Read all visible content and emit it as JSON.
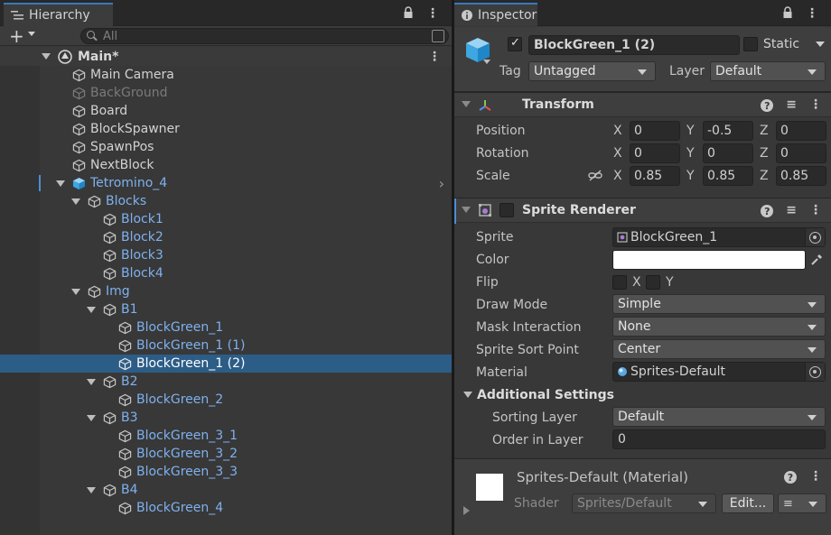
{
  "hierarchy": {
    "tab_label": "Hierarchy",
    "add_label": "+",
    "search_placeholder": "All",
    "scene": "Main*",
    "items": [
      {
        "label": "Main Camera",
        "depth": 0,
        "kind": "go",
        "style": "normal"
      },
      {
        "label": "BackGround",
        "depth": 0,
        "kind": "go",
        "style": "grey"
      },
      {
        "label": "Board",
        "depth": 0,
        "kind": "go",
        "style": "normal"
      },
      {
        "label": "BlockSpawner",
        "depth": 0,
        "kind": "go",
        "style": "normal"
      },
      {
        "label": "SpawnPos",
        "depth": 0,
        "kind": "go",
        "style": "normal"
      },
      {
        "label": "NextBlock",
        "depth": 0,
        "kind": "go",
        "style": "normal"
      },
      {
        "label": "Tetromino_4",
        "depth": 0,
        "kind": "prefab",
        "style": "blue",
        "expanded": true
      },
      {
        "label": "Blocks",
        "depth": 1,
        "kind": "go",
        "style": "blue",
        "expanded": true
      },
      {
        "label": "Block1",
        "depth": 2,
        "kind": "go",
        "style": "blue"
      },
      {
        "label": "Block2",
        "depth": 2,
        "kind": "go",
        "style": "blue"
      },
      {
        "label": "Block3",
        "depth": 2,
        "kind": "go",
        "style": "blue"
      },
      {
        "label": "Block4",
        "depth": 2,
        "kind": "go",
        "style": "blue"
      },
      {
        "label": "Img",
        "depth": 1,
        "kind": "go",
        "style": "blue",
        "expanded": true
      },
      {
        "label": "B1",
        "depth": 2,
        "kind": "go",
        "style": "blue",
        "expanded": true
      },
      {
        "label": "BlockGreen_1",
        "depth": 3,
        "kind": "go",
        "style": "blue"
      },
      {
        "label": "BlockGreen_1 (1)",
        "depth": 3,
        "kind": "go",
        "style": "blue"
      },
      {
        "label": "BlockGreen_1 (2)",
        "depth": 3,
        "kind": "go",
        "style": "blue",
        "selected": true
      },
      {
        "label": "B2",
        "depth": 2,
        "kind": "go",
        "style": "blue",
        "expanded": true
      },
      {
        "label": "BlockGreen_2",
        "depth": 3,
        "kind": "go",
        "style": "blue"
      },
      {
        "label": "B3",
        "depth": 2,
        "kind": "go",
        "style": "blue",
        "expanded": true
      },
      {
        "label": "BlockGreen_3_1",
        "depth": 3,
        "kind": "go",
        "style": "blue"
      },
      {
        "label": "BlockGreen_3_2",
        "depth": 3,
        "kind": "go",
        "style": "blue"
      },
      {
        "label": "BlockGreen_3_3",
        "depth": 3,
        "kind": "go",
        "style": "blue"
      },
      {
        "label": "B4",
        "depth": 2,
        "kind": "go",
        "style": "blue",
        "expanded": true
      },
      {
        "label": "BlockGreen_4",
        "depth": 3,
        "kind": "go",
        "style": "blue"
      }
    ]
  },
  "inspector": {
    "tab_label": "Inspector",
    "object_name": "BlockGreen_1 (2)",
    "static_label": "Static",
    "tag_label": "Tag",
    "tag_value": "Untagged",
    "layer_label": "Layer",
    "layer_value": "Default",
    "transform": {
      "title": "Transform",
      "position_label": "Position",
      "rotation_label": "Rotation",
      "scale_label": "Scale",
      "position": {
        "x": "0",
        "y": "-0.5",
        "z": "0"
      },
      "rotation": {
        "x": "0",
        "y": "0",
        "z": "0"
      },
      "scale": {
        "x": "0.85",
        "y": "0.85",
        "z": "0.85"
      },
      "axis_x": "X",
      "axis_y": "Y",
      "axis_z": "Z"
    },
    "sprite_renderer": {
      "title": "Sprite Renderer",
      "sprite_label": "Sprite",
      "sprite_value": "BlockGreen_1",
      "color_label": "Color",
      "color_value": "#ffffff",
      "flip_label": "Flip",
      "flip_x": "X",
      "flip_y": "Y",
      "draw_mode_label": "Draw Mode",
      "draw_mode_value": "Simple",
      "mask_label": "Mask Interaction",
      "mask_value": "None",
      "sort_point_label": "Sprite Sort Point",
      "sort_point_value": "Center",
      "material_label": "Material",
      "material_value": "Sprites-Default",
      "additional_label": "Additional Settings",
      "sorting_layer_label": "Sorting Layer",
      "sorting_layer_value": "Default",
      "order_label": "Order in Layer",
      "order_value": "0"
    },
    "material": {
      "title": "Sprites-Default (Material)",
      "shader_label": "Shader",
      "shader_value": "Sprites/Default",
      "edit_label": "Edit..."
    }
  },
  "colors": {
    "selection": "#2c5d87",
    "prefab_text": "#7eb1ee",
    "panel_bg": "#383838"
  }
}
